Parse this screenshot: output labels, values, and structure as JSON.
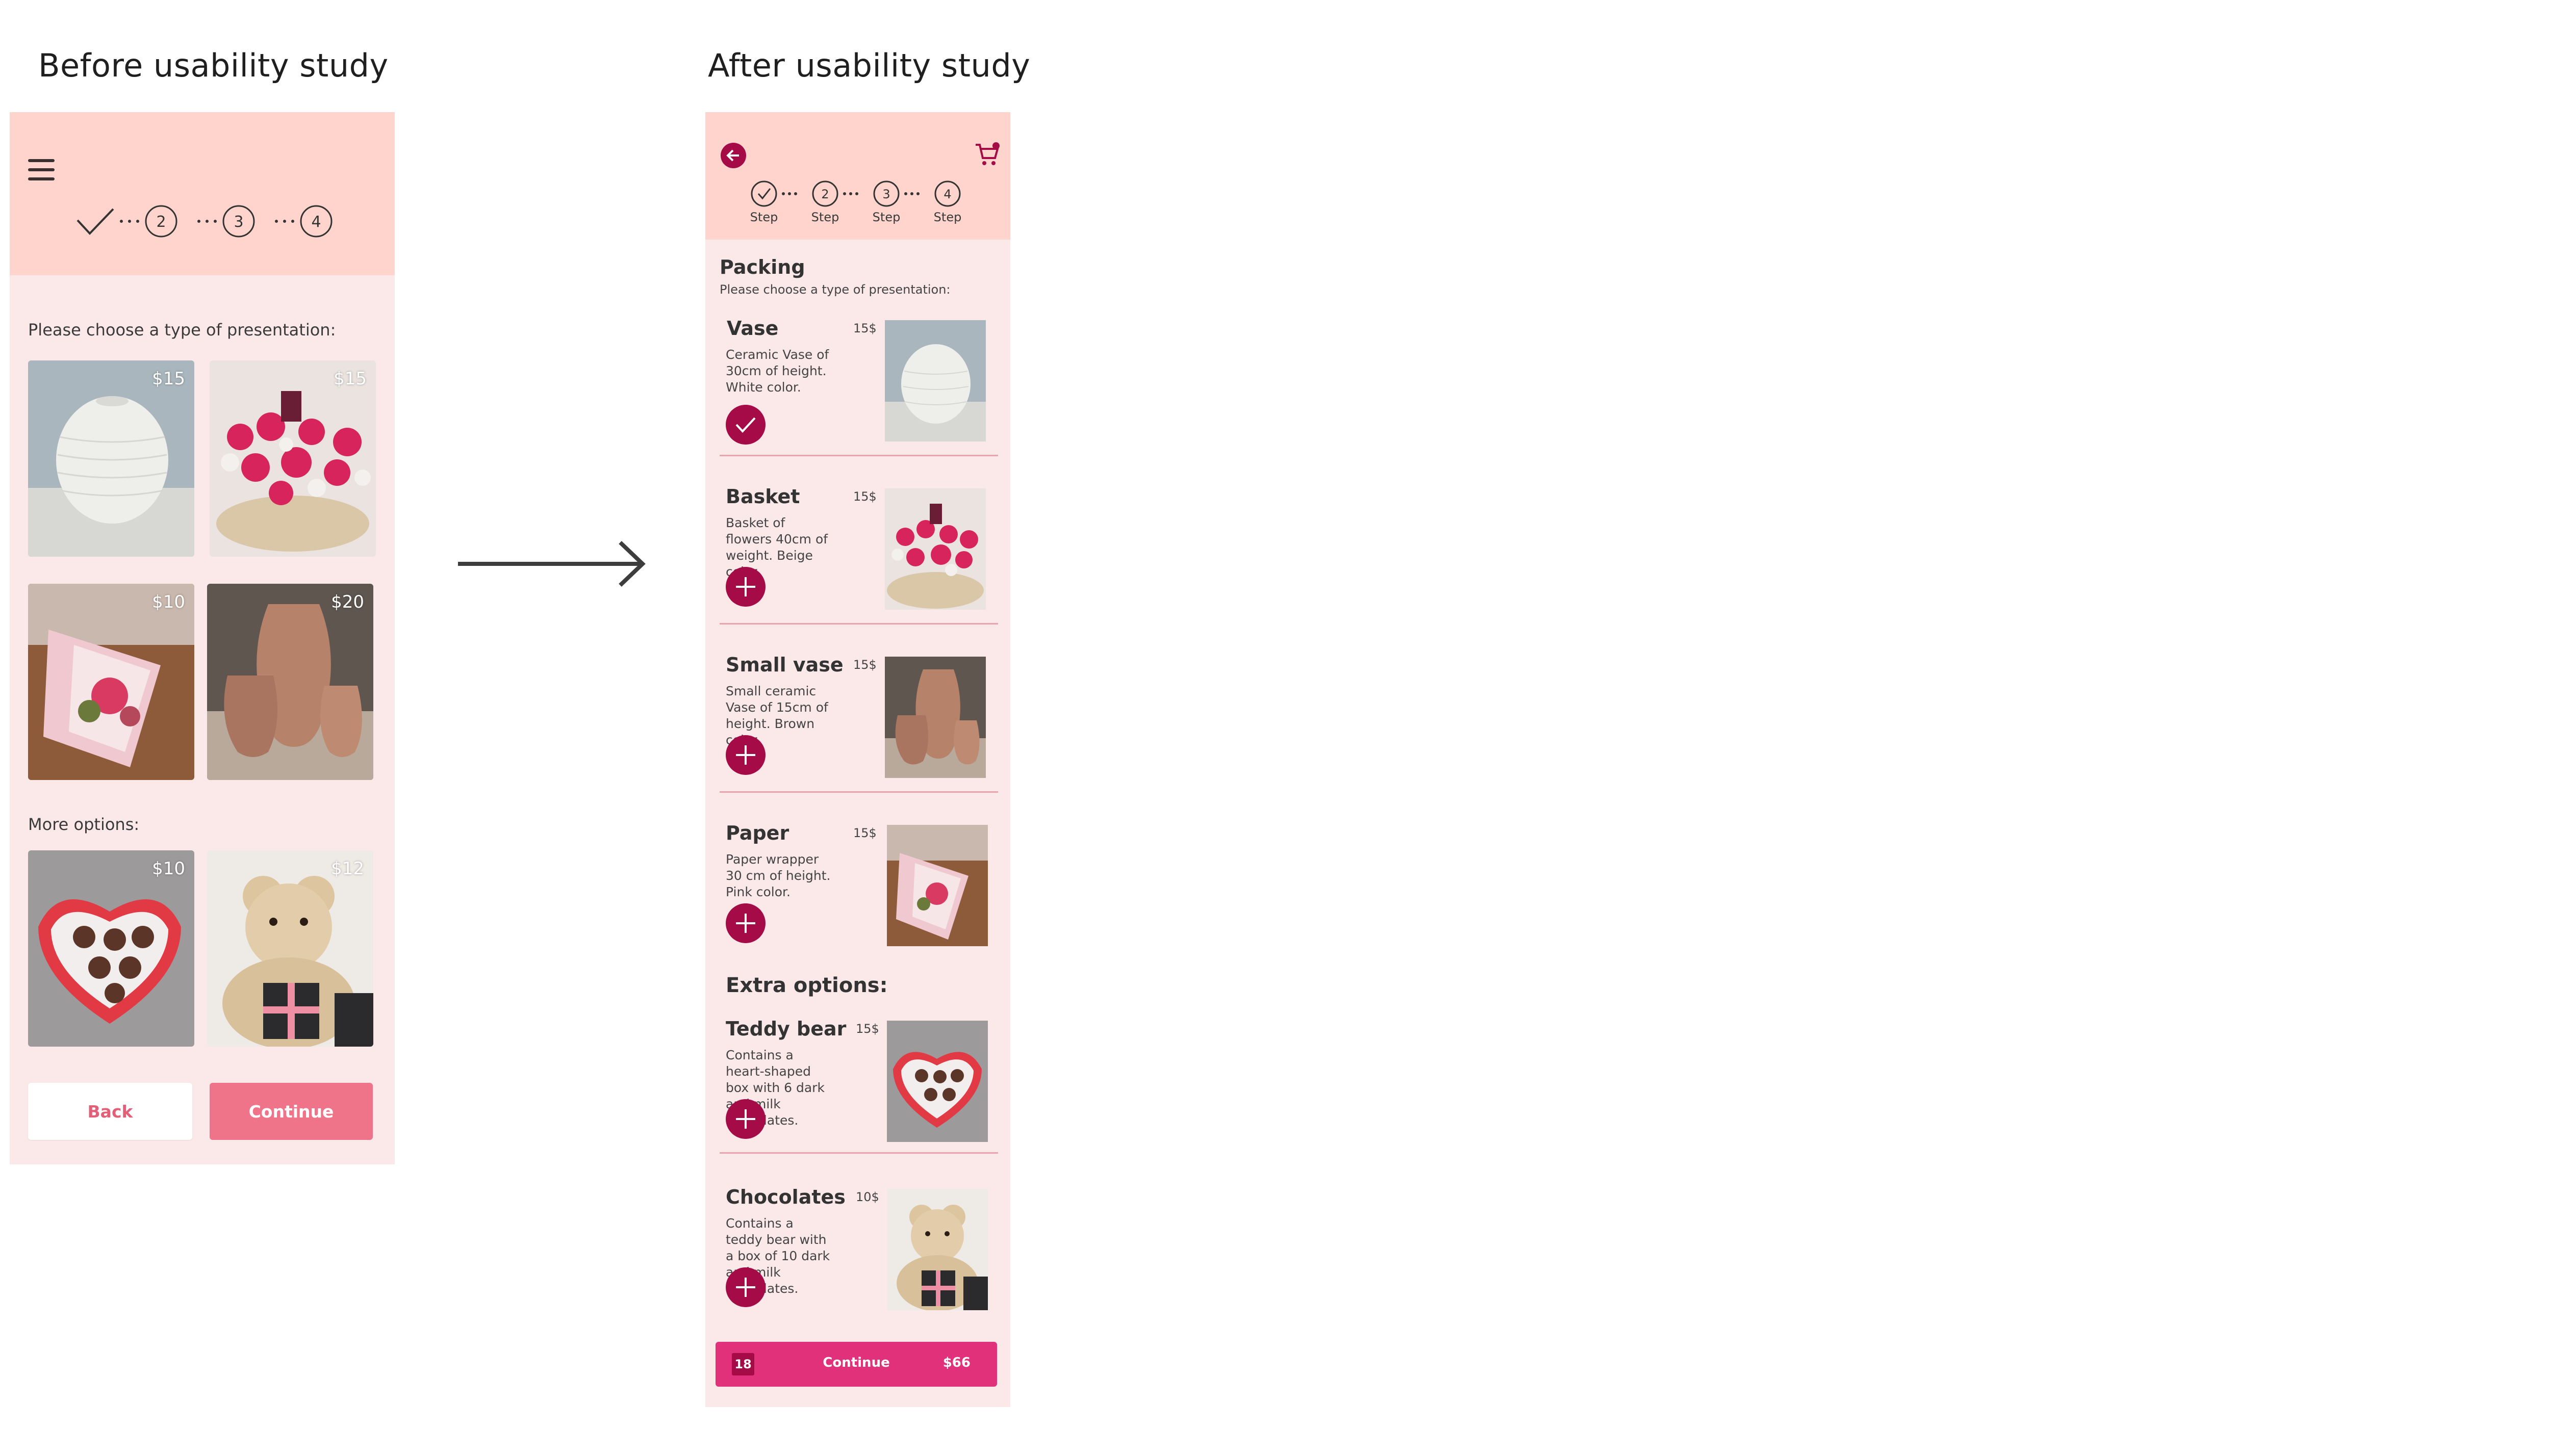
{
  "colors": {
    "header": "#ffd4cc",
    "panel": "#fbe9ea",
    "accent": "#a50b46",
    "button_primary": "#f07489",
    "continue_bar": "#e0317a"
  },
  "before": {
    "title": "Before usability study",
    "menu_icon": "hamburger-menu-icon",
    "steps": [
      "2",
      "3",
      "4"
    ],
    "prompt": "Please choose a type of presentation:",
    "options": [
      {
        "name": "vase",
        "price": "$15"
      },
      {
        "name": "basket",
        "price": "$15"
      },
      {
        "name": "paper",
        "price": "$10"
      },
      {
        "name": "small-vase",
        "price": "$20"
      }
    ],
    "more_label": "More options:",
    "more_options": [
      {
        "name": "chocolates",
        "price": "$10"
      },
      {
        "name": "teddy-bear",
        "price": "$12"
      }
    ],
    "back_label": "Back",
    "continue_label": "Continue"
  },
  "after": {
    "title": "After usability study",
    "back_icon": "back-arrow-icon",
    "cart_icon": "cart-icon",
    "steps": [
      "2",
      "3",
      "4"
    ],
    "step_labels": [
      "Step",
      "Step",
      "Step",
      "Step"
    ],
    "section_title": "Packing",
    "prompt": "Please choose a type of presentation:",
    "items": [
      {
        "name": "Vase",
        "price": "15$",
        "desc": "Ceramic Vase of 30cm of height. White color.",
        "selected": true
      },
      {
        "name": "Basket",
        "price": "15$",
        "desc": "Basket of flowers 40cm of weight. Beige color.",
        "selected": false
      },
      {
        "name": "Small vase",
        "price": "15$",
        "desc": "Small ceramic Vase of 15cm of height. Brown color.",
        "selected": false
      },
      {
        "name": "Paper",
        "price": "15$",
        "desc": "Paper wrapper 30 cm of height. Pink color.",
        "selected": false
      }
    ],
    "extra_title": "Extra options:",
    "extras": [
      {
        "name": "Teddy bear",
        "price": "15$",
        "desc": "Contains a heart-shaped box with 6 dark and milk chocolates.",
        "selected": false
      },
      {
        "name": "Chocolates",
        "price": "10$",
        "desc": "Contains a teddy bear with a box of 10 dark and milk chocolates.",
        "selected": false
      }
    ],
    "cart_count": "18",
    "continue_label": "Continue",
    "total": "$66"
  }
}
